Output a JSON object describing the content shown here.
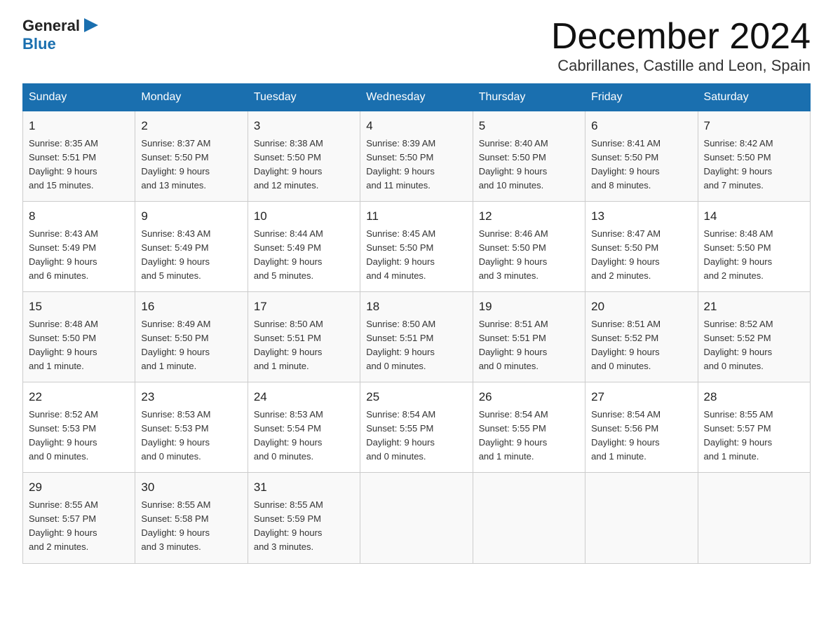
{
  "logo": {
    "general": "General",
    "blue": "Blue"
  },
  "title": "December 2024",
  "subtitle": "Cabrillanes, Castille and Leon, Spain",
  "days": [
    "Sunday",
    "Monday",
    "Tuesday",
    "Wednesday",
    "Thursday",
    "Friday",
    "Saturday"
  ],
  "weeks": [
    [
      {
        "day": "1",
        "sunrise": "8:35 AM",
        "sunset": "5:51 PM",
        "daylight": "9 hours and 15 minutes."
      },
      {
        "day": "2",
        "sunrise": "8:37 AM",
        "sunset": "5:50 PM",
        "daylight": "9 hours and 13 minutes."
      },
      {
        "day": "3",
        "sunrise": "8:38 AM",
        "sunset": "5:50 PM",
        "daylight": "9 hours and 12 minutes."
      },
      {
        "day": "4",
        "sunrise": "8:39 AM",
        "sunset": "5:50 PM",
        "daylight": "9 hours and 11 minutes."
      },
      {
        "day": "5",
        "sunrise": "8:40 AM",
        "sunset": "5:50 PM",
        "daylight": "9 hours and 10 minutes."
      },
      {
        "day": "6",
        "sunrise": "8:41 AM",
        "sunset": "5:50 PM",
        "daylight": "9 hours and 8 minutes."
      },
      {
        "day": "7",
        "sunrise": "8:42 AM",
        "sunset": "5:50 PM",
        "daylight": "9 hours and 7 minutes."
      }
    ],
    [
      {
        "day": "8",
        "sunrise": "8:43 AM",
        "sunset": "5:49 PM",
        "daylight": "9 hours and 6 minutes."
      },
      {
        "day": "9",
        "sunrise": "8:43 AM",
        "sunset": "5:49 PM",
        "daylight": "9 hours and 5 minutes."
      },
      {
        "day": "10",
        "sunrise": "8:44 AM",
        "sunset": "5:49 PM",
        "daylight": "9 hours and 5 minutes."
      },
      {
        "day": "11",
        "sunrise": "8:45 AM",
        "sunset": "5:50 PM",
        "daylight": "9 hours and 4 minutes."
      },
      {
        "day": "12",
        "sunrise": "8:46 AM",
        "sunset": "5:50 PM",
        "daylight": "9 hours and 3 minutes."
      },
      {
        "day": "13",
        "sunrise": "8:47 AM",
        "sunset": "5:50 PM",
        "daylight": "9 hours and 2 minutes."
      },
      {
        "day": "14",
        "sunrise": "8:48 AM",
        "sunset": "5:50 PM",
        "daylight": "9 hours and 2 minutes."
      }
    ],
    [
      {
        "day": "15",
        "sunrise": "8:48 AM",
        "sunset": "5:50 PM",
        "daylight": "9 hours and 1 minute."
      },
      {
        "day": "16",
        "sunrise": "8:49 AM",
        "sunset": "5:50 PM",
        "daylight": "9 hours and 1 minute."
      },
      {
        "day": "17",
        "sunrise": "8:50 AM",
        "sunset": "5:51 PM",
        "daylight": "9 hours and 1 minute."
      },
      {
        "day": "18",
        "sunrise": "8:50 AM",
        "sunset": "5:51 PM",
        "daylight": "9 hours and 0 minutes."
      },
      {
        "day": "19",
        "sunrise": "8:51 AM",
        "sunset": "5:51 PM",
        "daylight": "9 hours and 0 minutes."
      },
      {
        "day": "20",
        "sunrise": "8:51 AM",
        "sunset": "5:52 PM",
        "daylight": "9 hours and 0 minutes."
      },
      {
        "day": "21",
        "sunrise": "8:52 AM",
        "sunset": "5:52 PM",
        "daylight": "9 hours and 0 minutes."
      }
    ],
    [
      {
        "day": "22",
        "sunrise": "8:52 AM",
        "sunset": "5:53 PM",
        "daylight": "9 hours and 0 minutes."
      },
      {
        "day": "23",
        "sunrise": "8:53 AM",
        "sunset": "5:53 PM",
        "daylight": "9 hours and 0 minutes."
      },
      {
        "day": "24",
        "sunrise": "8:53 AM",
        "sunset": "5:54 PM",
        "daylight": "9 hours and 0 minutes."
      },
      {
        "day": "25",
        "sunrise": "8:54 AM",
        "sunset": "5:55 PM",
        "daylight": "9 hours and 0 minutes."
      },
      {
        "day": "26",
        "sunrise": "8:54 AM",
        "sunset": "5:55 PM",
        "daylight": "9 hours and 1 minute."
      },
      {
        "day": "27",
        "sunrise": "8:54 AM",
        "sunset": "5:56 PM",
        "daylight": "9 hours and 1 minute."
      },
      {
        "day": "28",
        "sunrise": "8:55 AM",
        "sunset": "5:57 PM",
        "daylight": "9 hours and 1 minute."
      }
    ],
    [
      {
        "day": "29",
        "sunrise": "8:55 AM",
        "sunset": "5:57 PM",
        "daylight": "9 hours and 2 minutes."
      },
      {
        "day": "30",
        "sunrise": "8:55 AM",
        "sunset": "5:58 PM",
        "daylight": "9 hours and 3 minutes."
      },
      {
        "day": "31",
        "sunrise": "8:55 AM",
        "sunset": "5:59 PM",
        "daylight": "9 hours and 3 minutes."
      },
      null,
      null,
      null,
      null
    ]
  ],
  "labels": {
    "sunrise": "Sunrise:",
    "sunset": "Sunset:",
    "daylight": "Daylight:"
  }
}
